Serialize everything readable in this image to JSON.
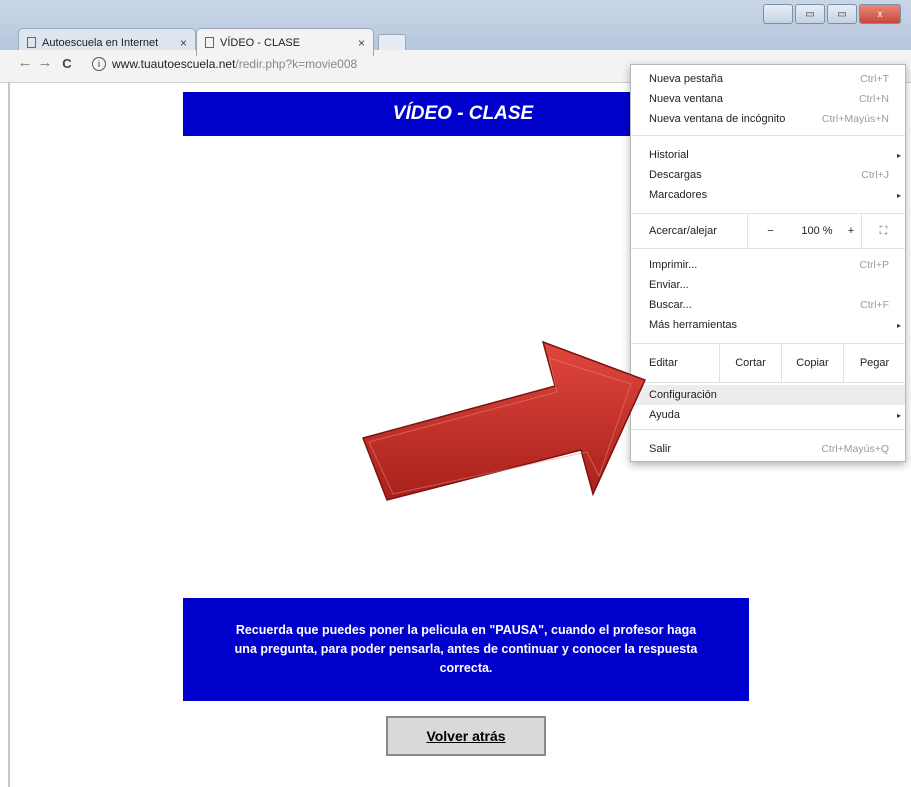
{
  "browser": {
    "tabs": [
      {
        "title": "Autoescuela en Internet",
        "close": "×"
      },
      {
        "title": "VÍDEO - CLASE",
        "close": "×"
      }
    ],
    "nav": {
      "back": "←",
      "forward": "→",
      "reload": "C"
    },
    "url": {
      "info": "i",
      "domain": "www.tuautoescuela.net",
      "path": "/redir.php?k=movie008"
    },
    "window_buttons": {
      "minimize": "▭",
      "maximize": "▭",
      "close": "x"
    }
  },
  "page": {
    "header": "VÍDEO - CLASE",
    "notice": "Recuerda que puedes poner la pelicula en \"PAUSA\", cuando el profesor haga una pregunta, para poder pensarla, antes de continuar y conocer la respuesta correcta.",
    "back_button": "Volver atrás"
  },
  "menu": {
    "new_tab": {
      "label": "Nueva pestaña",
      "shortcut": "Ctrl+T"
    },
    "new_window": {
      "label": "Nueva ventana",
      "shortcut": "Ctrl+N"
    },
    "incognito": {
      "label": "Nueva ventana de incógnito",
      "shortcut": "Ctrl+Mayús+N"
    },
    "history": {
      "label": "Historial",
      "arrow": "▸"
    },
    "downloads": {
      "label": "Descargas",
      "shortcut": "Ctrl+J"
    },
    "bookmarks": {
      "label": "Marcadores",
      "arrow": "▸"
    },
    "zoom": {
      "label": "Acercar/alejar",
      "minus": "−",
      "value": "100 %",
      "plus": "+",
      "fullscreen": "⛶"
    },
    "print": {
      "label": "Imprimir...",
      "shortcut": "Ctrl+P"
    },
    "cast": {
      "label": "Enviar..."
    },
    "find": {
      "label": "Buscar...",
      "shortcut": "Ctrl+F"
    },
    "more_tools": {
      "label": "Más herramientas",
      "arrow": "▸"
    },
    "edit": {
      "label": "Editar",
      "cut": "Cortar",
      "copy": "Copiar",
      "paste": "Pegar"
    },
    "settings": {
      "label": "Configuración"
    },
    "help": {
      "label": "Ayuda",
      "arrow": "▸"
    },
    "exit": {
      "label": "Salir",
      "shortcut": "Ctrl+Mayús+Q"
    }
  },
  "colors": {
    "page_blue": "#0000cc",
    "arrow_red": "#cc2a22"
  }
}
